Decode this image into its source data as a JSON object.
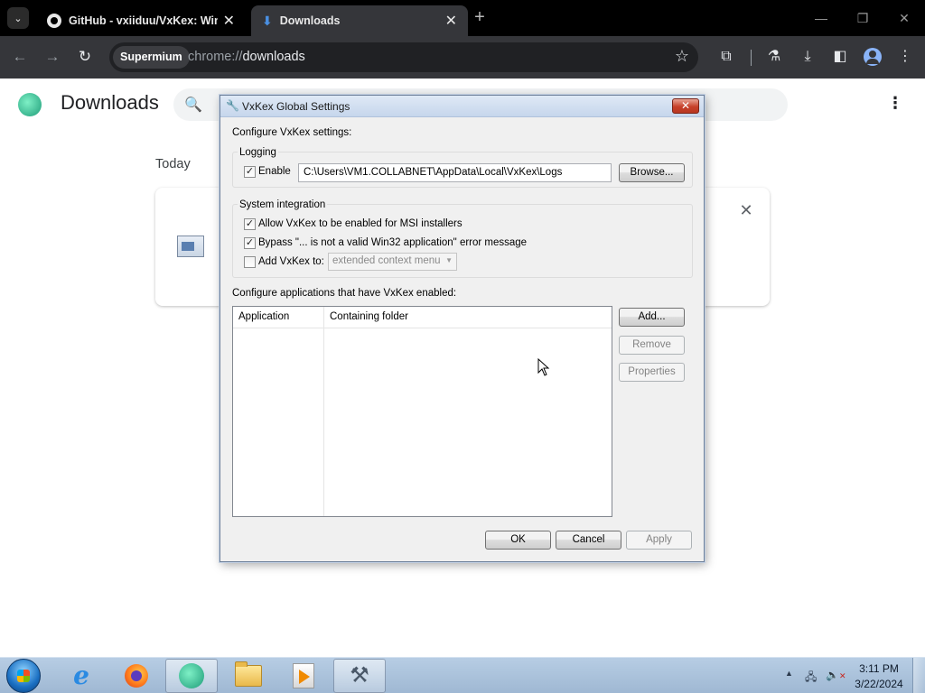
{
  "browser": {
    "tabs": [
      {
        "title": "GitHub - vxiiduu/VxKex: Windo",
        "active": false
      },
      {
        "title": "Downloads",
        "active": true
      }
    ],
    "omnibox": {
      "site_chip": "Supermium",
      "url_scheme": "chrome://",
      "url_path": "downloads"
    },
    "icons": {
      "tab_search": "chevron-down-icon",
      "new_tab": "plus-icon",
      "back": "arrow-left-icon",
      "forward": "arrow-right-icon",
      "reload": "reload-icon",
      "bookmark": "star-icon",
      "extensions": "puzzle-icon",
      "labs": "flask-icon",
      "downloads": "download-icon",
      "side_panel": "side-panel-icon",
      "profile": "profile-icon",
      "menu": "kebab-icon"
    }
  },
  "downloads_page": {
    "title": "Downloads",
    "date_group": "Today"
  },
  "dialog": {
    "title": "VxKex Global Settings",
    "intro": "Configure VxKex settings:",
    "logging": {
      "group_label": "Logging",
      "enable_label": "Enable",
      "enable_checked": true,
      "path": "C:\\Users\\VM1.COLLABNET\\AppData\\Local\\VxKex\\Logs",
      "browse_label": "Browse..."
    },
    "system_integration": {
      "group_label": "System integration",
      "msi_label": "Allow VxKex to be enabled for MSI installers",
      "msi_checked": true,
      "bypass_label": "Bypass \"... is not a valid Win32 application\" error message",
      "bypass_checked": true,
      "add_label": "Add VxKex to:",
      "add_checked": false,
      "add_combo_value": "extended context menu"
    },
    "apps": {
      "label": "Configure applications that have VxKex enabled:",
      "columns": [
        "Application",
        "Containing folder"
      ],
      "rows": [],
      "add_label": "Add...",
      "remove_label": "Remove",
      "properties_label": "Properties"
    },
    "footer": {
      "ok_label": "OK",
      "cancel_label": "Cancel",
      "apply_label": "Apply"
    }
  },
  "taskbar": {
    "apps": [
      {
        "name": "Internet Explorer",
        "active": false
      },
      {
        "name": "Firefox",
        "active": false
      },
      {
        "name": "Supermium",
        "active": true
      },
      {
        "name": "Windows Explorer",
        "active": false
      },
      {
        "name": "Media Player",
        "active": false
      },
      {
        "name": "VxKex Config",
        "active": true
      }
    ],
    "clock": {
      "time": "3:11 PM",
      "date": "3/22/2024"
    }
  }
}
